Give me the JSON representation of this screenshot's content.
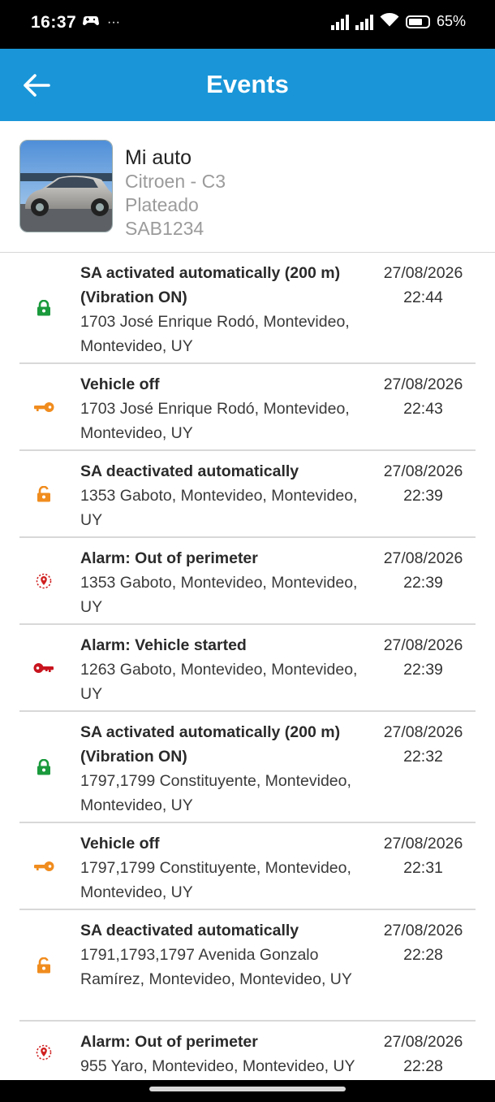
{
  "status_bar": {
    "time": "16:37",
    "extra": "···",
    "battery": "65%"
  },
  "header": {
    "title": "Events",
    "back_icon": "arrow-left-icon"
  },
  "vehicle": {
    "name": "Mi auto",
    "model": "Citroen - C3",
    "color": "Plateado",
    "plate": "SAB1234"
  },
  "event_colors": {
    "lock": "#1a9a3c",
    "unlock": "#f08c1e",
    "perimeter": "#d02020",
    "started": "#c8141e"
  },
  "events": [
    {
      "icon": "lock-green-icon",
      "title": "SA activated automatically  (200 m) (Vibration ON)",
      "address": "1703 José Enrique Rodó, Montevideo, Montevideo, UY",
      "date": "27/08/2026",
      "time": "22:44"
    },
    {
      "icon": "key-orange-icon",
      "title": "Vehicle off",
      "address": "1703 José Enrique Rodó, Montevideo, Montevideo, UY",
      "date": "27/08/2026",
      "time": "22:43"
    },
    {
      "icon": "unlock-orange-icon",
      "title": "SA deactivated automatically",
      "address": "1353 Gaboto, Montevideo, Montevideo, UY",
      "date": "27/08/2026",
      "time": "22:39"
    },
    {
      "icon": "map-pin-red-icon",
      "title": "Alarm: Out of perimeter",
      "address": "1353 Gaboto, Montevideo, Montevideo, UY",
      "date": "27/08/2026",
      "time": "22:39"
    },
    {
      "icon": "key-red-icon",
      "title": "Alarm: Vehicle started",
      "address": "1263 Gaboto, Montevideo, Montevideo, UY",
      "date": "27/08/2026",
      "time": "22:39"
    },
    {
      "icon": "lock-green-icon",
      "title": "SA activated automatically  (200 m) (Vibration ON)",
      "address": "1797,1799 Constituyente, Montevideo, Montevideo, UY",
      "date": "27/08/2026",
      "time": "22:32"
    },
    {
      "icon": "key-orange-icon",
      "title": "Vehicle off",
      "address": "1797,1799 Constituyente, Montevideo, Montevideo, UY",
      "date": "27/08/2026",
      "time": "22:31"
    },
    {
      "icon": "unlock-orange-icon",
      "title": "SA deactivated automatically",
      "address": "1791,1793,1797 Avenida Gonzalo Ramírez, Montevideo, Montevideo, UY",
      "date": "27/08/2026",
      "time": "22:28"
    },
    {
      "icon": "map-pin-red-icon",
      "title": "Alarm: Out of perimeter",
      "address": "955 Yaro, Montevideo, Montevideo, UY",
      "date": "27/08/2026",
      "time": "22:28"
    }
  ]
}
